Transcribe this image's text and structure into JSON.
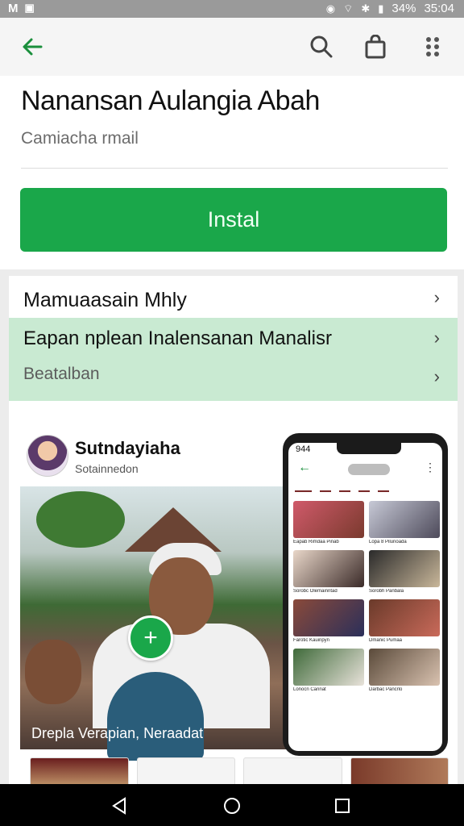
{
  "status_bar": {
    "left_icons": [
      "M",
      "gallery-icon"
    ],
    "battery": "34%",
    "time": "35:04"
  },
  "toolbar": {
    "icons": [
      "back-arrow-icon",
      "search-icon",
      "store-bag-icon",
      "more-vert-icon"
    ]
  },
  "app": {
    "title": "Nanansan Aulangia Abah",
    "subtitle": "Camiacha rmail",
    "install_label": "Instal"
  },
  "info_rows": [
    {
      "label": "Mamuaasain Mhly"
    },
    {
      "label": "Eapan nplean Inalensanan Manalisr"
    },
    {
      "label": "Beatalban"
    }
  ],
  "media": {
    "developer_name": "Sutndayiaha",
    "developer_sub": "Sotainnedon",
    "photo_caption": "Drepla Verapian, Neraadat",
    "phone": {
      "time": "944",
      "tiles": [
        {
          "caption": "Eapab Rimdaa Pinab"
        },
        {
          "caption": "Lopa 8 Pilunoada"
        },
        {
          "caption": "Sorobc Olemainntad"
        },
        {
          "caption": "Sorobh Panbala"
        },
        {
          "caption": "Farotic Kauinpyn"
        },
        {
          "caption": "Dmanic Pumaa"
        },
        {
          "caption": "Lonocn Cannat"
        },
        {
          "caption": "Darbac Pancrlo"
        }
      ]
    }
  },
  "colors": {
    "accent": "#1aa74a",
    "highlight": "#c9ead2",
    "back_arrow": "#1a8f3c"
  }
}
